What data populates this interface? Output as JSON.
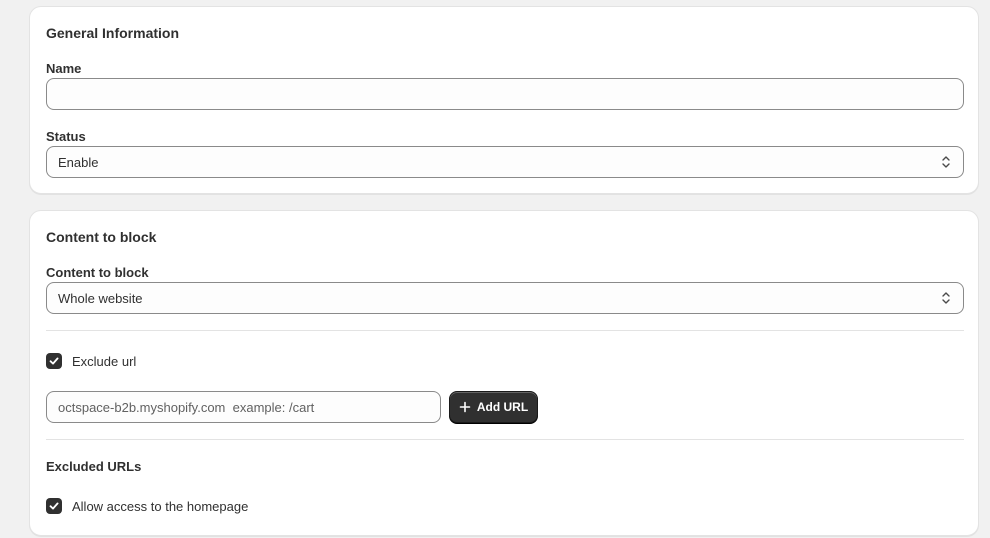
{
  "general": {
    "title": "General Information",
    "name_label": "Name",
    "name_value": "",
    "status_label": "Status",
    "status_value": "Enable"
  },
  "content": {
    "title": "Content to block",
    "content_label": "Content to block",
    "content_value": "Whole website",
    "exclude_label": "Exclude url",
    "exclude_checked": true,
    "url_placeholder": "octspace-b2b.myshopify.com  example: /cart",
    "add_url_label": "Add URL",
    "excluded_title": "Excluded URLs",
    "homepage_label": "Allow access to the homepage",
    "homepage_checked": true
  }
}
